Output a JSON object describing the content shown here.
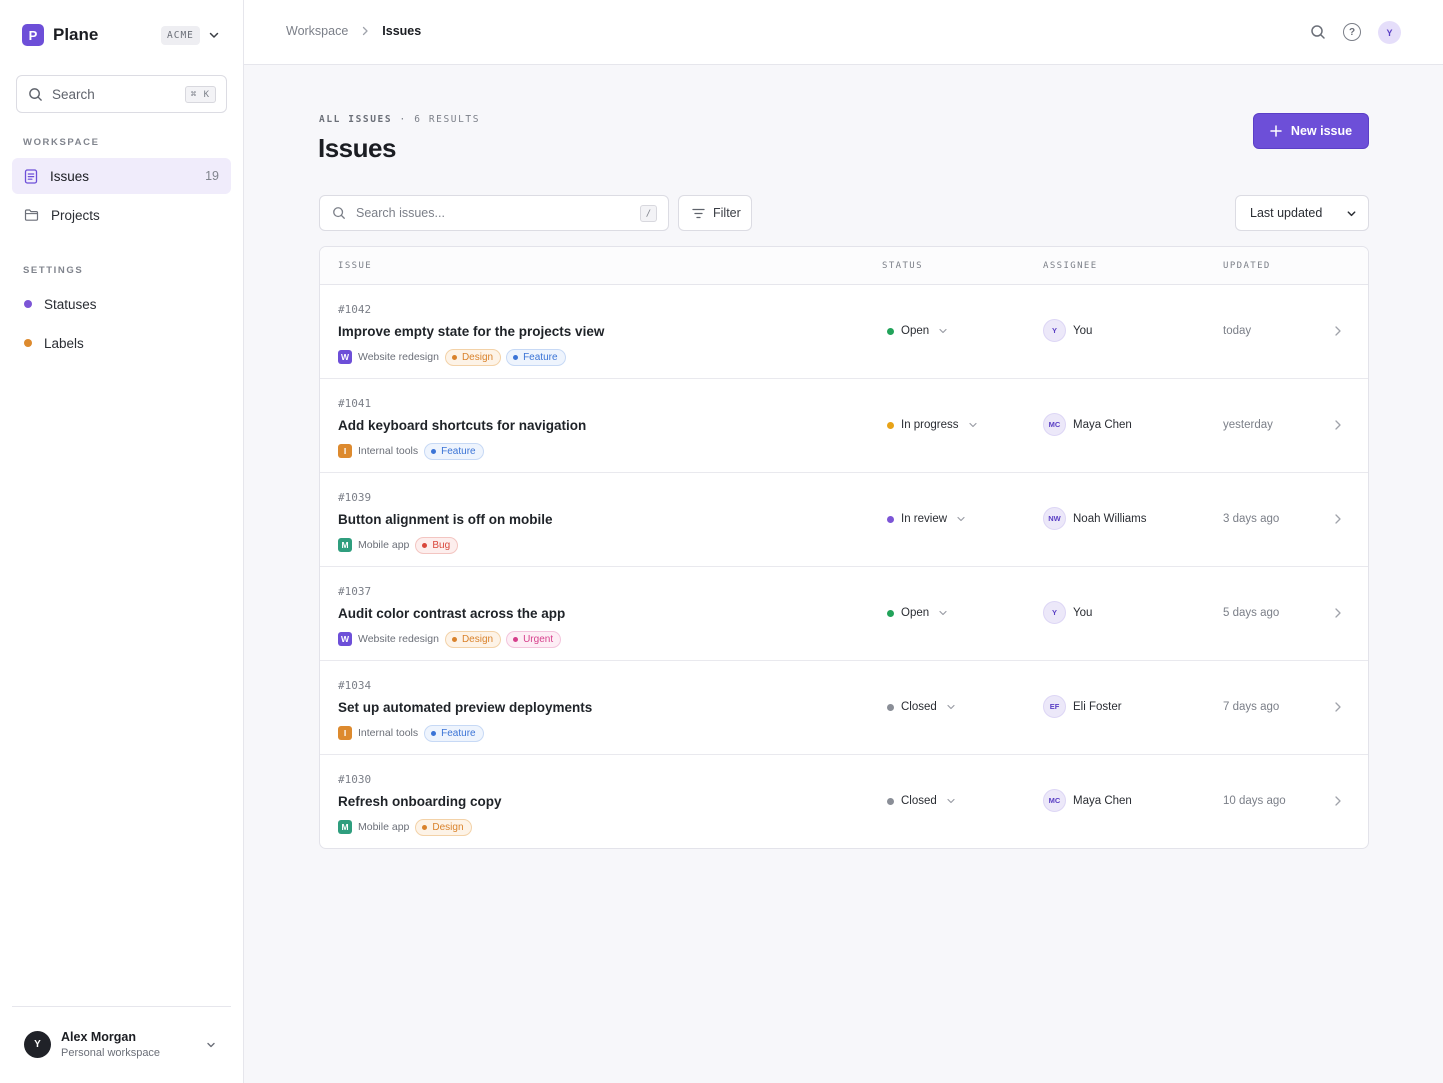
{
  "colors": {
    "accent": "#6d4fd8",
    "status_open": "#22a35a",
    "status_in_progress": "#e8a317",
    "status_in_review": "#7c55d6",
    "status_closed": "#8a8e97",
    "settings_statuses": "#7c55d6",
    "settings_labels": "#dd8a2e"
  },
  "sidebar": {
    "brand_initial": "P",
    "brand_name": "Plane",
    "workspace_badge": "ACME",
    "search": {
      "label": "Search",
      "shortcut": "⌘ K"
    },
    "workspace_section": "WORKSPACE",
    "nav": [
      {
        "label": "Issues",
        "count": "19",
        "icon": "document-icon"
      },
      {
        "label": "Projects",
        "icon": "folder-icon"
      }
    ],
    "settings_section": "SETTINGS",
    "settings": [
      {
        "label": "Statuses"
      },
      {
        "label": "Labels"
      }
    ],
    "user": {
      "initial": "Y",
      "name": "Alex Morgan",
      "subtitle": "Personal workspace"
    }
  },
  "topbar": {
    "breadcrumb": [
      "Workspace",
      "Issues"
    ],
    "help": "?",
    "avatar_initial": "Y"
  },
  "main": {
    "eyebrow_primary": "ALL ISSUES",
    "eyebrow_sep": "·",
    "eyebrow_secondary": "6 RESULTS",
    "title": "Issues",
    "new_button": "New issue",
    "search_placeholder": "Search issues...",
    "search_shortcut": "/",
    "filter_label": "Filter",
    "sort_label": "Last updated"
  },
  "table": {
    "headers": [
      "ISSUE",
      "STATUS",
      "ASSIGNEE",
      "UPDATED"
    ],
    "rows": [
      {
        "id": "#1042",
        "title": "Improve empty state for the projects view",
        "project_initial": "W",
        "project": "Website redesign",
        "project_color": "#6d4fd8",
        "tags": [
          {
            "label": "Design",
            "color": "#d9822b",
            "bg": "#fdf3e7",
            "border": "#f3d2a8"
          },
          {
            "label": "Feature",
            "color": "#3b74d6",
            "bg": "#eef4fd",
            "border": "#c7d9f5"
          }
        ],
        "status": "Open",
        "status_color": "#22a35a",
        "assignee_initials": "Y",
        "assignee": "You",
        "updated": "today"
      },
      {
        "id": "#1041",
        "title": "Add keyboard shortcuts for navigation",
        "project_initial": "I",
        "project": "Internal tools",
        "project_color": "#dd8a2e",
        "tags": [
          {
            "label": "Feature",
            "color": "#3b74d6",
            "bg": "#eef4fd",
            "border": "#c7d9f5"
          }
        ],
        "status": "In progress",
        "status_color": "#e8a317",
        "assignee_initials": "MC",
        "assignee": "Maya Chen",
        "updated": "yesterday"
      },
      {
        "id": "#1039",
        "title": "Button alignment is off on mobile",
        "project_initial": "M",
        "project": "Mobile app",
        "project_color": "#2f9e7e",
        "tags": [
          {
            "label": "Bug",
            "color": "#d9473b",
            "bg": "#fdeeed",
            "border": "#f3c5c1"
          }
        ],
        "status": "In review",
        "status_color": "#7c55d6",
        "assignee_initials": "NW",
        "assignee": "Noah Williams",
        "updated": "3 days ago"
      },
      {
        "id": "#1037",
        "title": "Audit color contrast across the app",
        "project_initial": "W",
        "project": "Website redesign",
        "project_color": "#6d4fd8",
        "tags": [
          {
            "label": "Design",
            "color": "#d9822b",
            "bg": "#fdf3e7",
            "border": "#f3d2a8"
          },
          {
            "label": "Urgent",
            "color": "#d63f8c",
            "bg": "#fdeef5",
            "border": "#f3c4dc"
          }
        ],
        "status": "Open",
        "status_color": "#22a35a",
        "assignee_initials": "Y",
        "assignee": "You",
        "updated": "5 days ago"
      },
      {
        "id": "#1034",
        "title": "Set up automated preview deployments",
        "project_initial": "I",
        "project": "Internal tools",
        "project_color": "#dd8a2e",
        "tags": [
          {
            "label": "Feature",
            "color": "#3b74d6",
            "bg": "#eef4fd",
            "border": "#c7d9f5"
          }
        ],
        "status": "Closed",
        "status_color": "#8a8e97",
        "assignee_initials": "EF",
        "assignee": "Eli Foster",
        "updated": "7 days ago"
      },
      {
        "id": "#1030",
        "title": "Refresh onboarding copy",
        "project_initial": "M",
        "project": "Mobile app",
        "project_color": "#2f9e7e",
        "tags": [
          {
            "label": "Design",
            "color": "#d9822b",
            "bg": "#fdf3e7",
            "border": "#f3d2a8"
          }
        ],
        "status": "Closed",
        "status_color": "#8a8e97",
        "assignee_initials": "MC",
        "assignee": "Maya Chen",
        "updated": "10 days ago"
      }
    ]
  }
}
